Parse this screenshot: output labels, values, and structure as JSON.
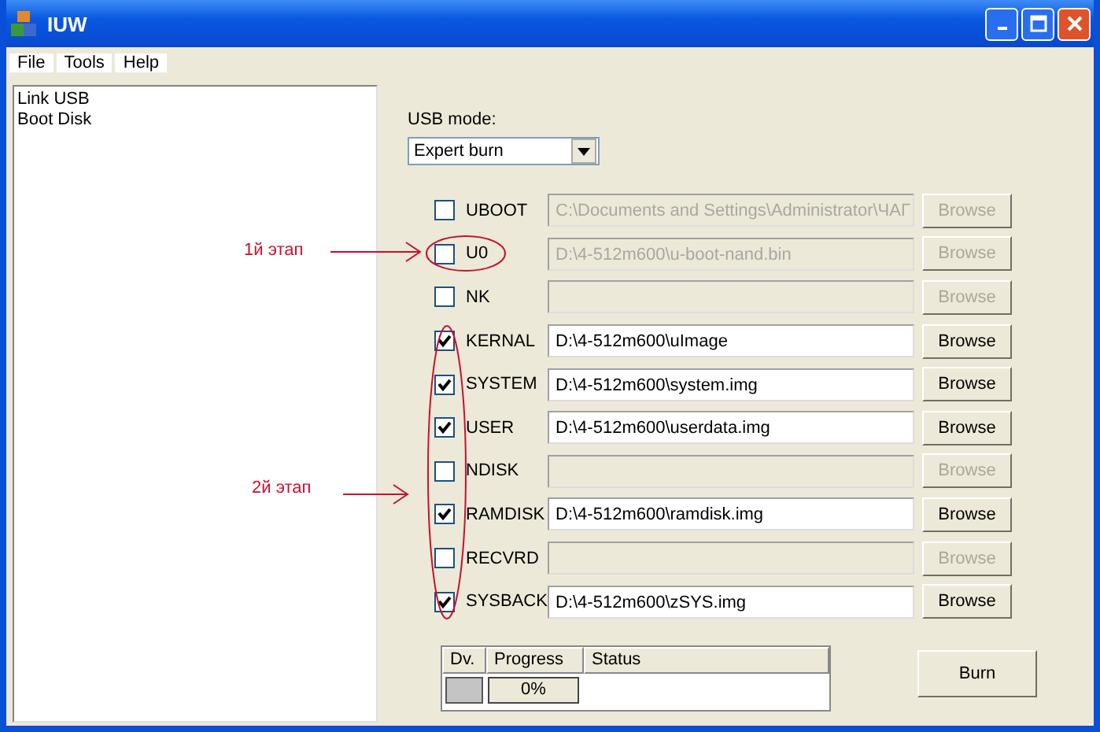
{
  "window": {
    "title": "IUW"
  },
  "menu": [
    "File",
    "Tools",
    "Help"
  ],
  "sidebar": {
    "items": [
      {
        "label": "Link USB"
      },
      {
        "label": "Boot Disk"
      }
    ]
  },
  "usb_mode": {
    "label": "USB mode:",
    "value": "Expert burn"
  },
  "images": [
    {
      "label": "UBOOT",
      "checked": false,
      "disabled": true,
      "path": "C:\\Documents and Settings\\Administrator\\ЧАГ",
      "button": "Browse"
    },
    {
      "label": "U0",
      "checked": false,
      "disabled": true,
      "path": "D:\\4-512m600\\u-boot-nand.bin",
      "button": "Browse"
    },
    {
      "label": "NK",
      "checked": false,
      "disabled": true,
      "button": "Browse"
    },
    {
      "label": "KERNAL",
      "checked": true,
      "disabled": false,
      "path": "D:\\4-512m600\\uImage",
      "button": "Browse"
    },
    {
      "label": "SYSTEM",
      "checked": true,
      "disabled": false,
      "path": "D:\\4-512m600\\system.img",
      "button": "Browse"
    },
    {
      "label": "USER",
      "checked": true,
      "disabled": false,
      "path": "D:\\4-512m600\\userdata.img",
      "button": "Browse"
    },
    {
      "label": "NDISK",
      "checked": false,
      "disabled": true,
      "button": "Browse"
    },
    {
      "label": "RAMDISK",
      "checked": true,
      "disabled": false,
      "path": "D:\\4-512m600\\ramdisk.img",
      "button": "Browse"
    },
    {
      "label": "RECVRD",
      "checked": false,
      "disabled": true,
      "button": "Browse"
    },
    {
      "label": "SYSBACK",
      "checked": true,
      "disabled": false,
      "path": "D:\\4-512m600\\zSYS.img",
      "button": "Browse"
    }
  ],
  "progress_table": {
    "columns": [
      "Dv.",
      "Progress",
      "Status"
    ],
    "rows": [
      {
        "progress": "0%",
        "level": 0
      }
    ]
  },
  "burn_button": "Burn",
  "annotations": [
    {
      "text": "1й этап"
    },
    {
      "text": "2й этап"
    }
  ]
}
